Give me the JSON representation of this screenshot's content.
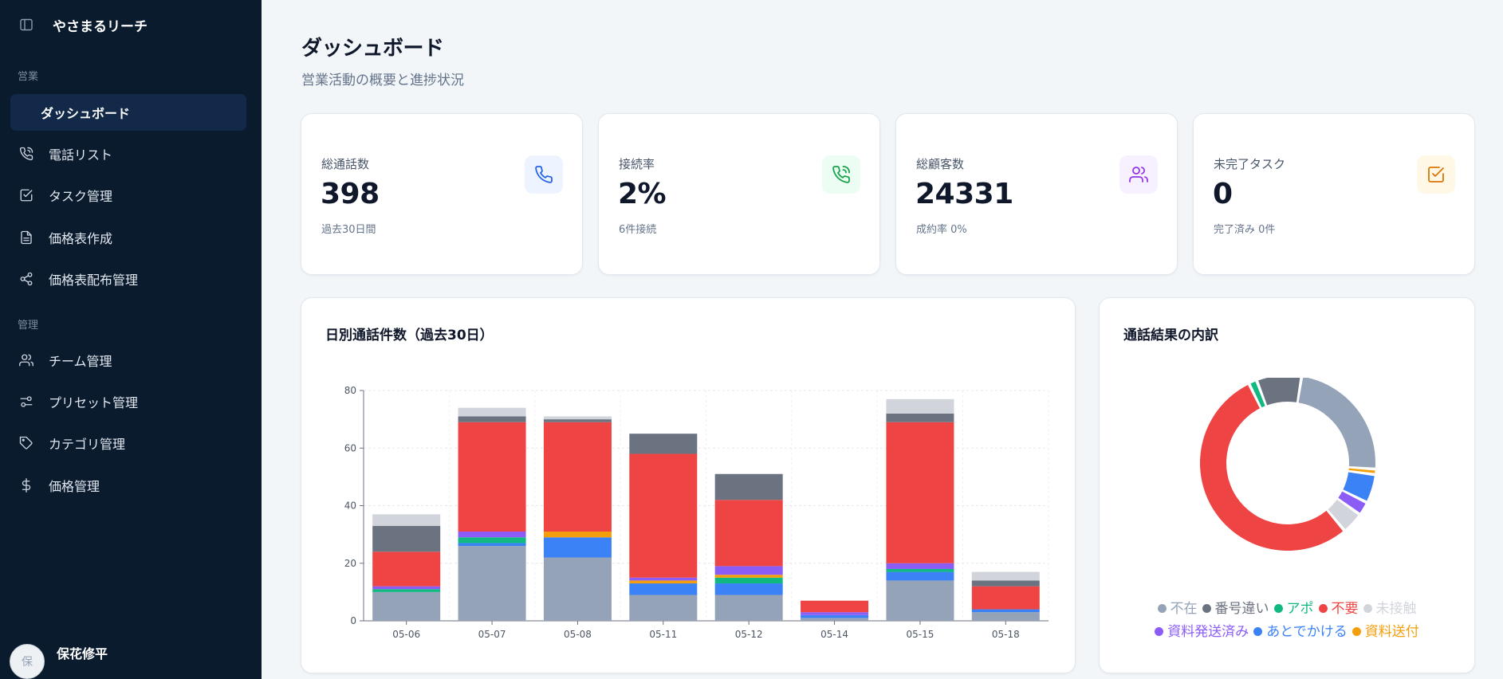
{
  "sidebar": {
    "brand": "やさまるリーチ",
    "sections": {
      "sales": "営業",
      "admin": "管理"
    },
    "items": [
      {
        "label": "ダッシュボード",
        "icon": "dashboard-icon"
      },
      {
        "label": "電話リスト",
        "icon": "phone-call-icon"
      },
      {
        "label": "タスク管理",
        "icon": "checkbox-icon"
      },
      {
        "label": "価格表作成",
        "icon": "file-text-icon"
      },
      {
        "label": "価格表配布管理",
        "icon": "share-icon"
      },
      {
        "label": "チーム管理",
        "icon": "users-icon"
      },
      {
        "label": "プリセット管理",
        "icon": "sliders-icon"
      },
      {
        "label": "カテゴリ管理",
        "icon": "tag-icon"
      },
      {
        "label": "価格管理",
        "icon": "dollar-icon"
      }
    ],
    "user": {
      "name": "保花修平",
      "initial": "保"
    }
  },
  "header": {
    "title": "ダッシュボード",
    "subtitle": "営業活動の概要と進捗状況"
  },
  "stats": [
    {
      "label": "総通話数",
      "value": "398",
      "note": "過去30日間",
      "icon": "phone-icon",
      "color": "#2563eb",
      "bg": "#eef4ff"
    },
    {
      "label": "接続率",
      "value": "2%",
      "note": "6件接続",
      "icon": "phone-call-icon",
      "color": "#16a34a",
      "bg": "#ecfdf3"
    },
    {
      "label": "総顧客数",
      "value": "24331",
      "note": "成約率 0%",
      "icon": "users-icon",
      "color": "#9333ea",
      "bg": "#f7f0fe"
    },
    {
      "label": "未完了タスク",
      "value": "0",
      "note": "完了済み 0件",
      "icon": "checkbox-icon",
      "color": "#d97706",
      "bg": "#fff8e6"
    }
  ],
  "daily_chart": {
    "title": "日別通話件数（過去30日）",
    "chart_data": {
      "type": "bar",
      "stacked": true,
      "categories": [
        "05-06",
        "05-07",
        "05-08",
        "05-11",
        "05-12",
        "05-14",
        "05-15",
        "05-18"
      ],
      "ylim": [
        0,
        80
      ],
      "yticks": [
        0,
        20,
        40,
        60,
        80
      ],
      "grid": true,
      "series": [
        {
          "name": "不在",
          "color": "#94a3b8",
          "values": [
            10,
            26,
            22,
            9,
            9,
            1,
            14,
            3
          ]
        },
        {
          "name": "あとでかける",
          "color": "#3b82f6",
          "values": [
            0,
            1,
            7,
            4,
            4,
            1,
            3,
            1
          ]
        },
        {
          "name": "アポ",
          "color": "#10b981",
          "values": [
            1,
            2,
            0,
            0,
            2,
            0,
            1,
            0
          ]
        },
        {
          "name": "資料送付",
          "color": "#f59e0b",
          "values": [
            0,
            0,
            2,
            1,
            1,
            0,
            0,
            0
          ]
        },
        {
          "name": "資料発送済み",
          "color": "#8b5cf6",
          "values": [
            1,
            2,
            0,
            1,
            3,
            1,
            2,
            0
          ]
        },
        {
          "name": "不要",
          "color": "#ef4444",
          "values": [
            12,
            38,
            38,
            43,
            23,
            4,
            49,
            8
          ]
        },
        {
          "name": "番号違い",
          "color": "#6b7280",
          "values": [
            9,
            2,
            1,
            7,
            9,
            0,
            3,
            2
          ]
        },
        {
          "name": "未接触",
          "color": "#d1d5db",
          "values": [
            4,
            3,
            1,
            0,
            0,
            0,
            5,
            3
          ]
        }
      ]
    }
  },
  "donut_chart": {
    "title": "通話結果の内訳",
    "chart_data": {
      "type": "pie",
      "donut": true,
      "slices": [
        {
          "name": "不在",
          "color": "#94a3b8",
          "value": 94
        },
        {
          "name": "資料送付",
          "color": "#f59e0b",
          "value": 4
        },
        {
          "name": "あとでかける",
          "color": "#3b82f6",
          "value": 21
        },
        {
          "name": "資料発送済み",
          "color": "#8b5cf6",
          "value": 10
        },
        {
          "name": "未接触",
          "color": "#d1d5db",
          "value": 16
        },
        {
          "name": "不要",
          "color": "#ef4444",
          "value": 215
        },
        {
          "name": "アポ",
          "color": "#10b981",
          "value": 6
        },
        {
          "name": "番号違い",
          "color": "#6b7280",
          "value": 33
        }
      ],
      "legend": [
        "不在",
        "番号違い",
        "アポ",
        "不要",
        "未接触",
        "資料発送済み",
        "あとでかける",
        "資料送付"
      ],
      "legend_position": "bottom"
    }
  }
}
